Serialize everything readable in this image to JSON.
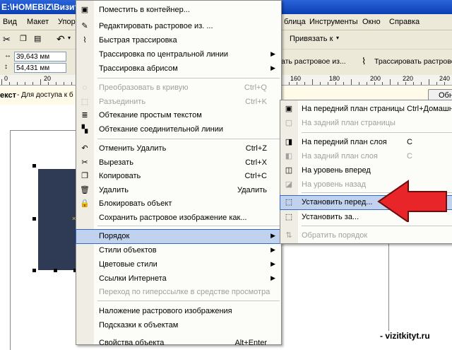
{
  "window": {
    "title": "E:\\HOMEBIZ\\Визитки\\"
  },
  "menubar": {
    "items": [
      "Вид",
      "Макет",
      "Упор"
    ],
    "right_items": [
      "блица",
      "Инструменты",
      "Окно",
      "Справка"
    ]
  },
  "toolbar": {
    "snap_to": "Привязать к",
    "width_value": "39,643 мм",
    "height_value": "54,431 мм",
    "trace_bitmap_short": "ать растровое из...",
    "trace_bitmap": "Трассировать растрово"
  },
  "ruler": {
    "left_ticks": [
      "0",
      "20"
    ],
    "right_ticks": [
      "160",
      "180",
      "200",
      "220",
      "240"
    ]
  },
  "hint": {
    "label": "екст",
    "text": " - Для доступа к б",
    "right_button": "Обн"
  },
  "context_menu": {
    "items": [
      {
        "label": "Поместить в контейнер...",
        "icon": "container-icon",
        "shortcut": "",
        "disabled": false
      },
      {
        "label": "Редактировать растровое из. ...",
        "icon": "edit-bitmap-icon",
        "shortcut": "",
        "disabled": false
      },
      {
        "label": "Быстрая трассировка",
        "icon": "quick-trace-icon",
        "shortcut": "",
        "disabled": false
      },
      {
        "label": "Трассировка по центральной линии",
        "icon": "",
        "shortcut": "",
        "disabled": false,
        "submenu": true
      },
      {
        "label": "Трассировка абрисом",
        "icon": "",
        "shortcut": "",
        "disabled": false,
        "submenu": true
      },
      {
        "label": "Преобразовать в кривую",
        "icon": "convert-curve-icon",
        "shortcut": "Ctrl+Q",
        "disabled": true
      },
      {
        "label": "Разъединить",
        "icon": "break-apart-icon",
        "shortcut": "Ctrl+K",
        "disabled": true
      },
      {
        "label": "Обтекание простым текстом",
        "icon": "wrap-text-icon",
        "shortcut": "",
        "disabled": false
      },
      {
        "label": "Обтекание соединительной линии",
        "icon": "wrap-connector-icon",
        "shortcut": "",
        "disabled": false
      },
      {
        "label": "Отменить Удалить",
        "icon": "undo-icon",
        "shortcut": "Ctrl+Z",
        "disabled": false
      },
      {
        "label": "Вырезать",
        "icon": "cut-icon",
        "shortcut": "Ctrl+X",
        "disabled": false
      },
      {
        "label": "Копировать",
        "icon": "copy-icon",
        "shortcut": "Ctrl+C",
        "disabled": false
      },
      {
        "label": "Удалить",
        "icon": "delete-icon",
        "shortcut": "Удалить",
        "disabled": false
      },
      {
        "label": "Блокировать объект",
        "icon": "lock-icon",
        "shortcut": "",
        "disabled": false
      },
      {
        "label": "Сохранить растровое изображение как...",
        "icon": "",
        "shortcut": "",
        "disabled": false
      },
      {
        "label": "Порядок",
        "icon": "",
        "shortcut": "",
        "disabled": false,
        "submenu": true,
        "highlighted": true
      },
      {
        "label": "Стили объектов",
        "icon": "",
        "shortcut": "",
        "disabled": false,
        "submenu": true
      },
      {
        "label": "Цветовые стили",
        "icon": "",
        "shortcut": "",
        "disabled": false,
        "submenu": true
      },
      {
        "label": "Ссылки Интернета",
        "icon": "",
        "shortcut": "",
        "disabled": false,
        "submenu": true
      },
      {
        "label": "Переход по гиперссылке в средстве просмотра",
        "icon": "",
        "shortcut": "",
        "disabled": true
      },
      {
        "label": "Наложение растрового изображения",
        "icon": "",
        "shortcut": "",
        "disabled": false
      },
      {
        "label": "Подсказки к объектам",
        "icon": "",
        "shortcut": "",
        "disabled": false
      },
      {
        "label": "Свойства объекта",
        "icon": "",
        "shortcut": "Alt+Enter",
        "disabled": false
      }
    ]
  },
  "order_submenu": {
    "items": [
      {
        "label": "На передний план страницы",
        "shortcut": "Ctrl+Домашня",
        "icon": "to-front-page-icon",
        "disabled": false
      },
      {
        "label": "На задний план страницы",
        "shortcut": "",
        "icon": "to-back-page-icon",
        "disabled": true
      },
      {
        "label": "На передний план слоя",
        "shortcut": "С",
        "icon": "to-front-layer-icon",
        "disabled": false
      },
      {
        "label": "На задний план слоя",
        "shortcut": "С",
        "icon": "to-back-layer-icon",
        "disabled": true
      },
      {
        "label": "На уровень вперед",
        "shortcut": "",
        "icon": "forward-one-icon",
        "disabled": false
      },
      {
        "label": "На уровень назад",
        "shortcut": "",
        "icon": "back-one-icon",
        "disabled": true
      },
      {
        "label": "Установить перед...",
        "shortcut": "",
        "icon": "in-front-of-icon",
        "disabled": false,
        "highlighted": true
      },
      {
        "label": "Установить за...",
        "shortcut": "",
        "icon": "behind-icon",
        "disabled": false
      },
      {
        "label": "Обратить порядок",
        "shortcut": "",
        "icon": "reverse-order-icon",
        "disabled": true
      }
    ]
  },
  "watermark": {
    "text": "- vizitkityt.ru"
  },
  "colors": {
    "accent_arrow": "#e8262a",
    "selected_object": "#2f3b55",
    "highlight": "#c1d2ee"
  }
}
